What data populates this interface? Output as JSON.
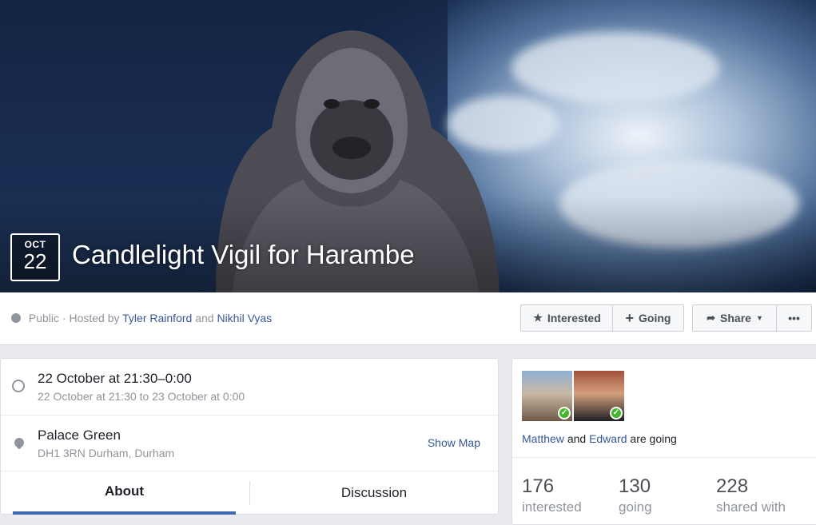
{
  "event": {
    "month": "OCT",
    "day": "22",
    "title": "Candlelight Vigil for Harambe"
  },
  "info": {
    "privacy": "Public",
    "hosted_by": "· Hosted by",
    "host1": "Tyler Rainford",
    "and": "and",
    "host2": "Nikhil Vyas"
  },
  "actions": {
    "interested": "Interested",
    "going": "Going",
    "share": "Share",
    "more": "•••"
  },
  "details": {
    "time_main": "22 October at 21:30–0:00",
    "time_sub": "22 October at 21:30 to 23 October at 0:00",
    "place_main": "Palace Green",
    "place_sub": "DH1 3RN Durham, Durham",
    "show_map": "Show Map"
  },
  "tabs": [
    "About",
    "Discussion"
  ],
  "friends": {
    "name1": "Matthew",
    "and": "and",
    "name2": "Edward",
    "suffix": "are going"
  },
  "stats": [
    {
      "num": "176",
      "label": "interested"
    },
    {
      "num": "130",
      "label": "going"
    },
    {
      "num": "228",
      "label": "shared with"
    }
  ],
  "icons": {
    "privacy": "globe-icon",
    "interested": "star-icon",
    "going": "plus-icon",
    "share": "share-arrow-icon",
    "time": "clock-icon",
    "location": "pin-icon"
  },
  "colors": {
    "link": "#365899",
    "tab_active": "#4267b2",
    "check": "#42b72a"
  }
}
